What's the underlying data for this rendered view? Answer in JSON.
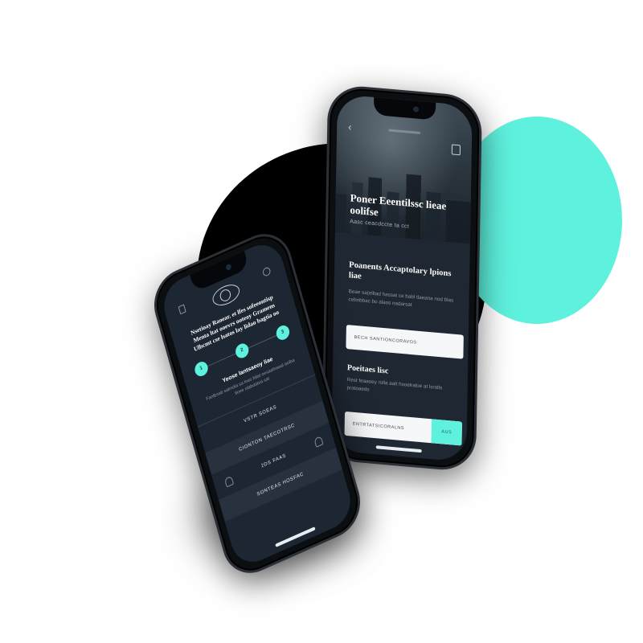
{
  "colors": {
    "accent": "#5ef1dd",
    "screen_bg": "#1e2732",
    "blob_dark": "#000000",
    "white": "#ffffff"
  },
  "right_phone": {
    "hero_title": "Poner Eeentilssc lieae oolifse",
    "hero_subtitle": "Aasc ceacdccte ta cct",
    "section1": {
      "title": "Poanents Accaptolary lpions liae",
      "text": "Beae sa(elltad hassat ce babl tlaeana nod blas cebnbbac bo alaos nadarsat"
    },
    "input1_value": "BECH SANTIONCORAVOS",
    "section2": {
      "title": "Poeitaes lisc",
      "text": "Rest feaaoey rolla aalt hsoelraloe at lsratls pratoaeds"
    },
    "input2_value": "ENTRTATSICORALNS",
    "input2_button": "AUS"
  },
  "left_phone": {
    "title": "Nsetioay Raoear. et lfes sofeeontisp Menta ltat ooevrs ooteoy Gramens Ulbcmt cse lsatos lay lidao bagtia oo",
    "steps": [
      "1",
      "2",
      "3"
    ],
    "subtitle": "Yeose lantsaeoy liae",
    "text": "Fanlbsatt salmdia sa loas btlat oesaalnaaal aolba tloee olabdatea sat",
    "rows": [
      "VSTR SOEAS",
      "CIONTON TAECOTRSC",
      "2DS FAAS",
      "SONTEAS HOSFAC"
    ]
  }
}
